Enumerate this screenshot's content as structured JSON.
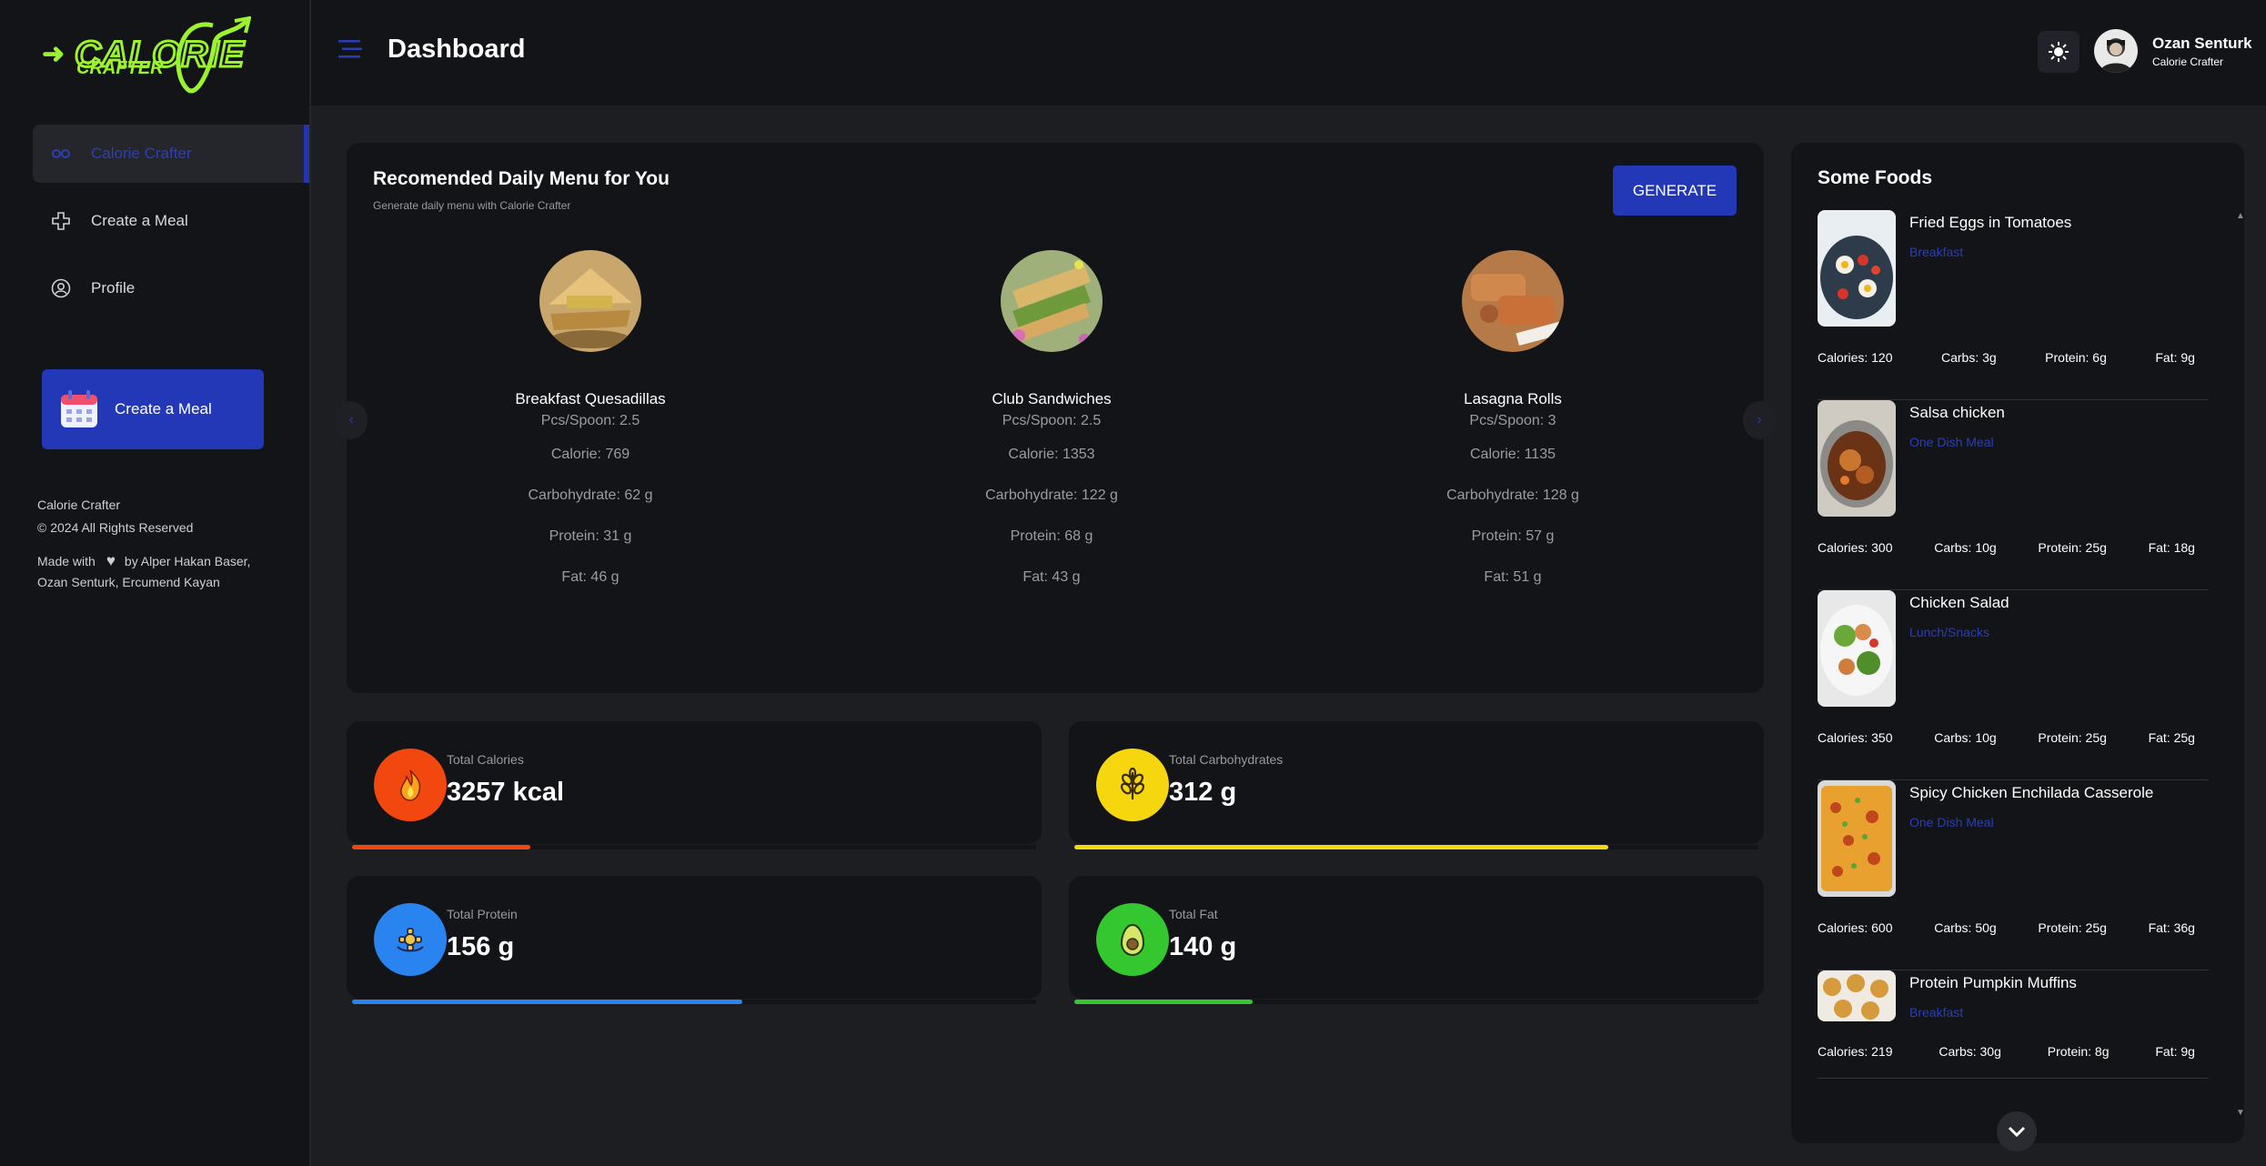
{
  "brand": {
    "logo_word1": "CALORIE",
    "logo_word2": "CRAFTER"
  },
  "sidebar": {
    "items": [
      {
        "label": "Calorie Crafter",
        "icon": "infinity-icon",
        "active": true
      },
      {
        "label": "Create a Meal",
        "icon": "plus-outline-icon",
        "active": false
      },
      {
        "label": "Profile",
        "icon": "user-circle-icon",
        "active": false
      }
    ],
    "cta_label": "Create a Meal",
    "footer": {
      "line1": "Calorie Crafter",
      "line2": "© 2024 All Rights Reserved",
      "made_with": "Made with",
      "by_line": "by Alper Hakan Baser,",
      "authors2": "Ozan Senturk, Ercumend Kayan"
    }
  },
  "header": {
    "title": "Dashboard",
    "user_name": "Ozan Senturk",
    "user_role": "Calorie Crafter"
  },
  "daily_menu": {
    "title": "Recomended Daily Menu for You",
    "subtitle": "Generate daily menu with Calorie Crafter",
    "generate_label": "GENERATE",
    "prev_arrow": "‹",
    "next_arrow": "›",
    "meals": [
      {
        "name": "Breakfast Quesadillas",
        "pcs": "Pcs/Spoon: 2.5",
        "calorie": "Calorie: 769",
        "carbs": "Carbohydrate: 62 g",
        "protein": "Protein: 31 g",
        "fat": "Fat: 46 g"
      },
      {
        "name": "Club Sandwiches",
        "pcs": "Pcs/Spoon: 2.5",
        "calorie": "Calorie: 1353",
        "carbs": "Carbohydrate: 122 g",
        "protein": "Protein: 68 g",
        "fat": "Fat: 43 g"
      },
      {
        "name": "Lasagna Rolls",
        "pcs": "Pcs/Spoon: 3",
        "calorie": "Calorie: 1135",
        "carbs": "Carbohydrate: 128 g",
        "protein": "Protein: 57 g",
        "fat": "Fat: 51 g"
      }
    ]
  },
  "stats": [
    {
      "label": "Total Calories",
      "value": "3257 kcal",
      "color": "#f2470f",
      "progress": 0.26
    },
    {
      "label": "Total Carbohydrates",
      "value": "312 g",
      "color": "#f5d60f",
      "progress": 0.78
    },
    {
      "label": "Total Protein",
      "value": "156 g",
      "color": "#2a84ef",
      "progress": 0.57
    },
    {
      "label": "Total Fat",
      "value": "140 g",
      "color": "#35c72f",
      "progress": 0.26
    }
  ],
  "foods": {
    "title": "Some Foods",
    "items": [
      {
        "name": "Fried Eggs in Tomatoes",
        "category": "Breakfast",
        "calories": "Calories: 120",
        "carbs": "Carbs: 3g",
        "protein": "Protein: 6g",
        "fat": "Fat: 9g"
      },
      {
        "name": "Salsa chicken",
        "category": "One Dish Meal",
        "calories": "Calories: 300",
        "carbs": "Carbs: 10g",
        "protein": "Protein: 25g",
        "fat": "Fat: 18g"
      },
      {
        "name": "Chicken Salad",
        "category": "Lunch/Snacks",
        "calories": "Calories: 350",
        "carbs": "Carbs: 10g",
        "protein": "Protein: 25g",
        "fat": "Fat: 25g"
      },
      {
        "name": "Spicy Chicken Enchilada Casserole",
        "category": "One Dish Meal",
        "calories": "Calories: 600",
        "carbs": "Carbs: 50g",
        "protein": "Protein: 25g",
        "fat": "Fat: 36g"
      },
      {
        "name": "Protein Pumpkin Muffins",
        "category": "Breakfast",
        "calories": "Calories: 219",
        "carbs": "Carbs: 30g",
        "protein": "Protein: 8g",
        "fat": "Fat: 9g"
      }
    ]
  },
  "colors": {
    "accent": "#2238b7",
    "brand_green": "#9bf22e",
    "background": "#1d1e22",
    "panel": "#131418"
  }
}
